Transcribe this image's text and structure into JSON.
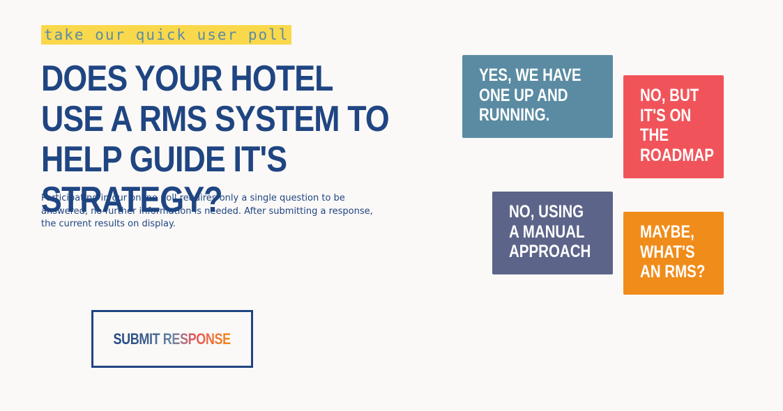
{
  "poll": {
    "tag": "take our quick user poll",
    "question": "Does your hotel use a RMS system to help guide it's strategy?",
    "description": "Participating in our online poll requires only a single question to be answered, no further information is needed. After submitting a response, the current results on display.",
    "submit_label": "Submit Response",
    "options": [
      {
        "label": "Yes, we have one up and running.",
        "color": "#5a8ba2"
      },
      {
        "label": "No, but it's on the roadmap",
        "color": "#f0545a"
      },
      {
        "label": "No, using a manual approach",
        "color": "#5c6489"
      },
      {
        "label": "Maybe, what's an RMS?",
        "color": "#f08c1a"
      }
    ]
  },
  "colors": {
    "primary": "#1f4582",
    "tag_bg": "#fad84c",
    "tag_text": "#5a8ca3",
    "background": "#fbf9f7"
  }
}
